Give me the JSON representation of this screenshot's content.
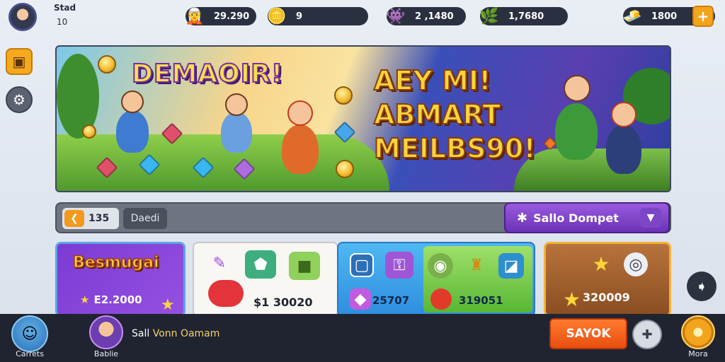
{
  "player": {
    "name": "Stad",
    "level": "10"
  },
  "resources": [
    {
      "icon": "character-token-icon",
      "value": "29.290"
    },
    {
      "icon": "gold-coin-icon",
      "value": "9"
    },
    {
      "icon": "gem-token-icon",
      "value": "2 ,1480"
    },
    {
      "icon": "green-crystal-icon",
      "value": "1,7680"
    },
    {
      "icon": "gold-nugget-icon",
      "value": "1800"
    }
  ],
  "banner": {
    "title": "DEMAOIR!",
    "headline": [
      "AEY MI!",
      "ABMART",
      "MEILBS90!"
    ]
  },
  "filter": {
    "count": "135",
    "label": "Daedi",
    "action_label": "Sallo Dompet"
  },
  "cards": {
    "featured_title": "Besmugai",
    "featured_price": "E2.2000",
    "bundle_price": "$1 30020",
    "price_a": "25707",
    "price_b": "319051",
    "gold_price": "320009"
  },
  "bottom": {
    "left_label": "Carrets",
    "profile_label": "Bablie",
    "name_first": "Sall",
    "name_rest": "Vonn Oamam",
    "cta_label": "SAYOK",
    "right_label": "Mora"
  },
  "colors": {
    "accent": "#f2a51c",
    "cta": "#e94f10",
    "purple": "#6b33b5"
  }
}
